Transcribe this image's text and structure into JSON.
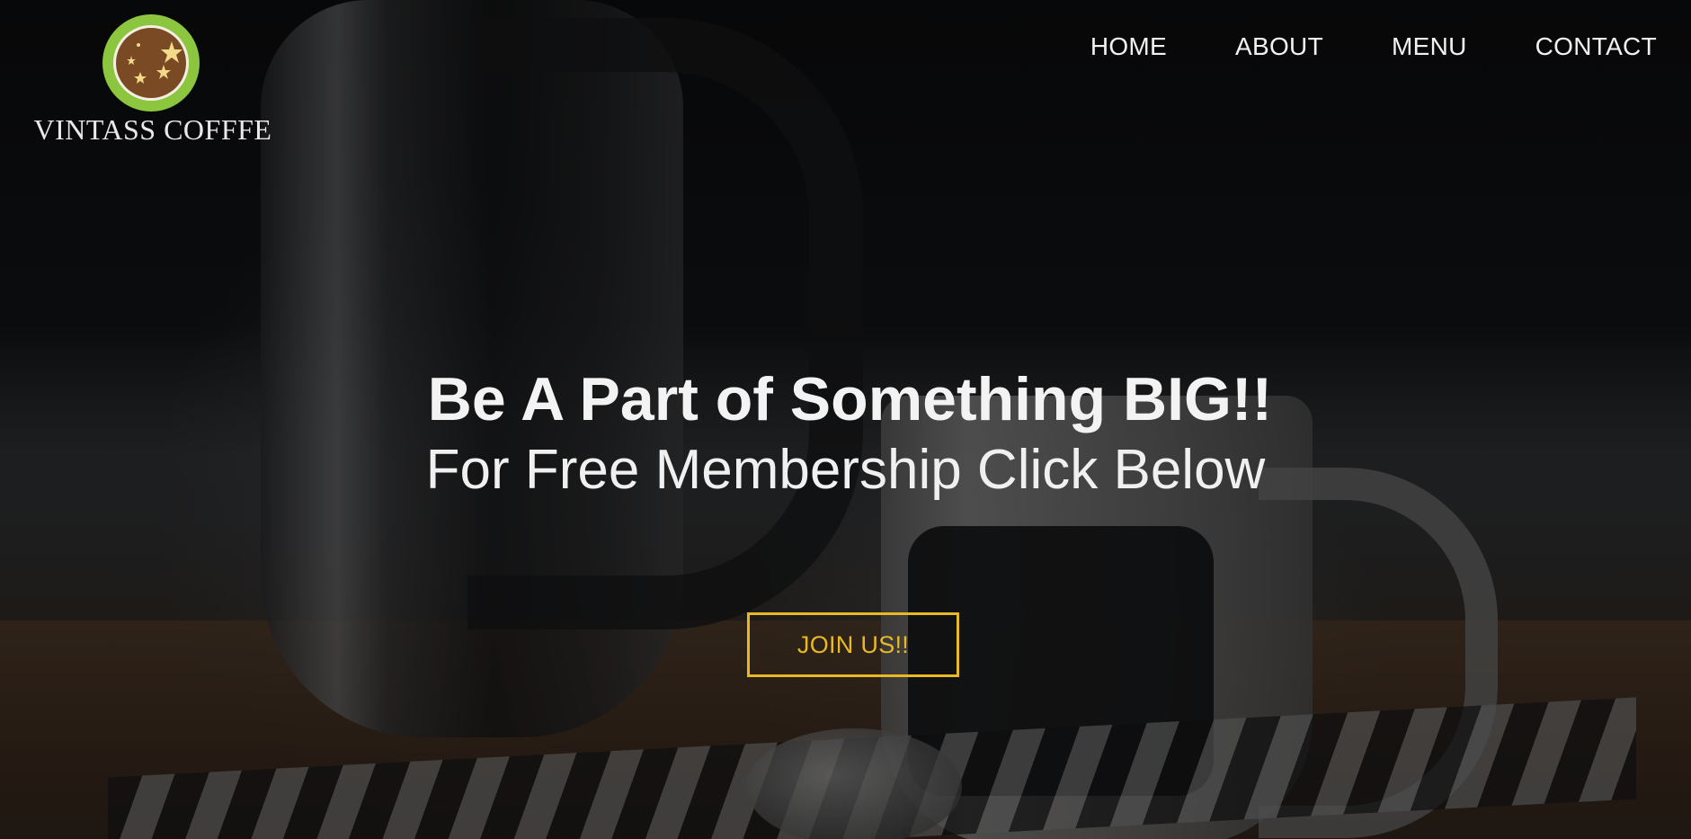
{
  "brand": {
    "name": "VINTASS COFFFE",
    "logo_icon": "coffee-bean-stars-icon",
    "colors": {
      "ring": "#8cc63f",
      "bean": "#7a4a25",
      "stars": "#f3d98a"
    }
  },
  "nav": {
    "items": [
      {
        "label": "HOME"
      },
      {
        "label": "ABOUT"
      },
      {
        "label": "MENU"
      },
      {
        "label": "CONTACT"
      }
    ]
  },
  "hero": {
    "headline": "Be A Part of Something BIG!!",
    "subline": "For Free Membership Click Below",
    "cta_label": "JOIN US!!",
    "cta_color": "#e8b923",
    "background_image": "coffee-pot-and-mug-photo"
  }
}
